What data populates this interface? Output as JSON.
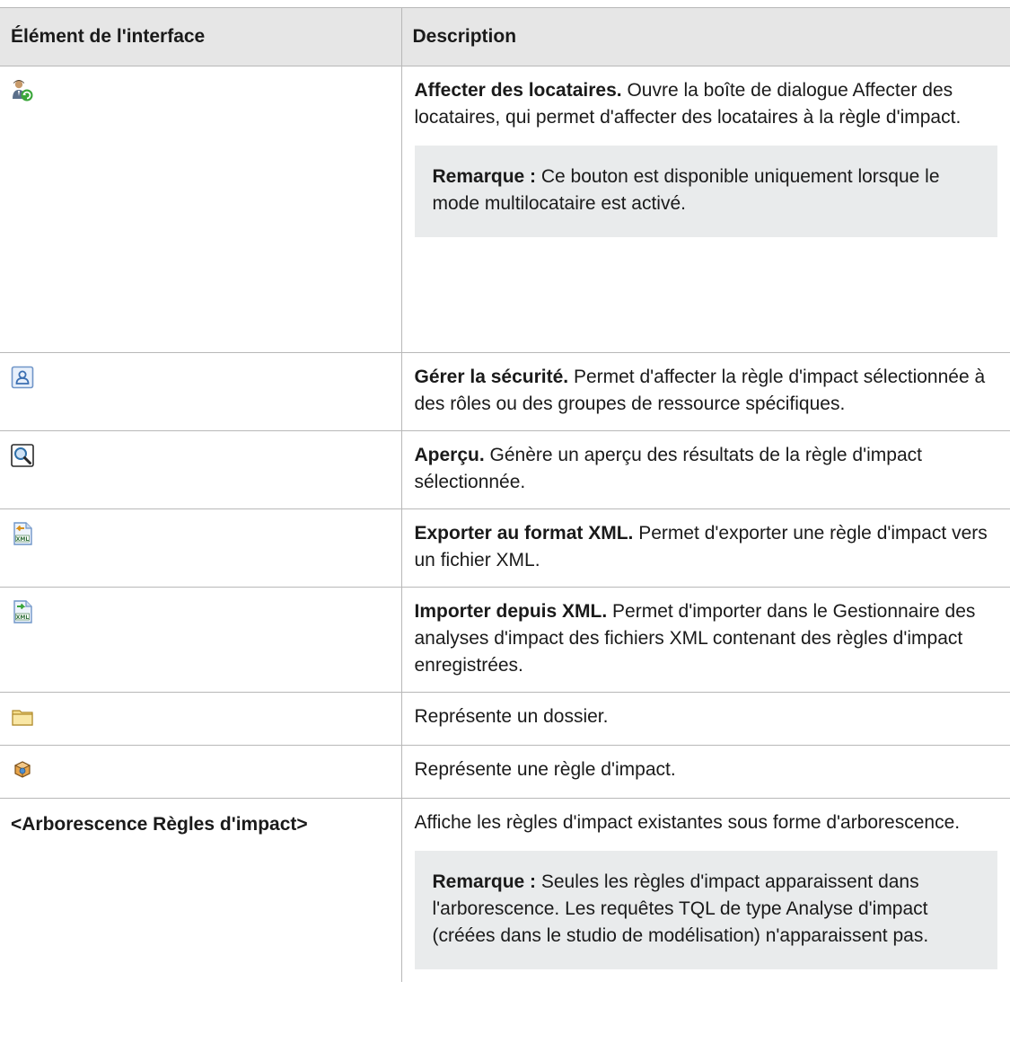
{
  "table": {
    "headers": {
      "element": "Élément de l'interface",
      "description": "Description"
    },
    "rows": [
      {
        "icon": "assign-tenants-icon",
        "term": "Affecter des locataires.",
        "text": " Ouvre la boîte de dialogue Affecter des locataires, qui permet d'affecter des locataires à la règle d'impact.",
        "note_label": "Remarque :",
        "note_text": " Ce bouton est disponible uniquement lorsque le mode multilocataire est activé."
      },
      {
        "icon": "manage-security-icon",
        "term": "Gérer la sécurité.",
        "text": " Permet d'affecter la règle d'impact sélectionnée à des rôles ou des groupes de ressource spécifiques."
      },
      {
        "icon": "preview-icon",
        "term": "Aperçu.",
        "text": " Génère un aperçu des résultats de la règle d'impact sélectionnée."
      },
      {
        "icon": "export-xml-icon",
        "term": "Exporter au format XML.",
        "text": " Permet d'exporter une règle d'impact vers un fichier XML."
      },
      {
        "icon": "import-xml-icon",
        "term": "Importer depuis XML.",
        "text": " Permet d'importer dans le Gestionnaire des analyses d'impact des fichiers XML contenant des règles d'impact enregistrées."
      },
      {
        "icon": "folder-icon",
        "text": "Représente un dossier."
      },
      {
        "icon": "impact-rule-icon",
        "text": "Représente une règle d'impact."
      },
      {
        "element_text": "<Arborescence Règles d'impact>",
        "text": "Affiche les règles d'impact existantes sous forme d'arborescence.",
        "note_label": "Remarque :",
        "note_text": " Seules les règles d'impact apparaissent dans l'arborescence. Les requêtes TQL de type Analyse d'impact (créées dans le studio de modélisation) n'apparaissent pas."
      }
    ]
  },
  "colors": {
    "header_bg": "#e6e6e6",
    "note_bg": "#e9ebec",
    "border": "#b8b8b8"
  }
}
